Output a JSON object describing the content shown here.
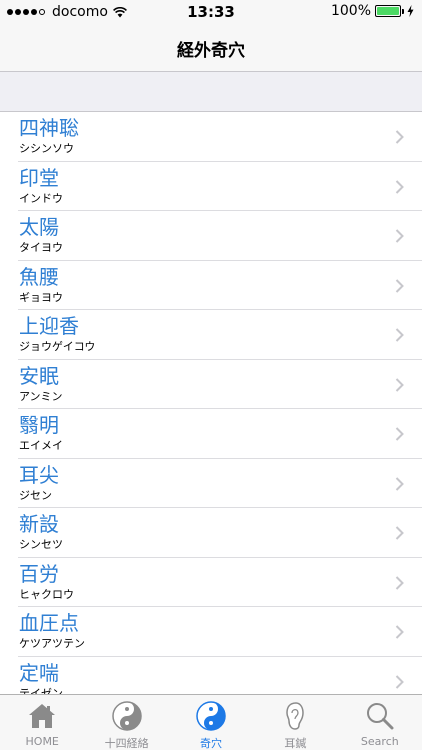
{
  "status_bar": {
    "carrier": "docomo",
    "time": "13:33",
    "battery_percent": "100%",
    "battery_level": 1.0
  },
  "nav": {
    "title": "経外奇穴"
  },
  "list": {
    "items": [
      {
        "name": "四神聡",
        "reading": "シシンソウ"
      },
      {
        "name": "印堂",
        "reading": "インドウ"
      },
      {
        "name": "太陽",
        "reading": "タイヨウ"
      },
      {
        "name": "魚腰",
        "reading": "ギョヨウ"
      },
      {
        "name": "上迎香",
        "reading": "ジョウゲイコウ"
      },
      {
        "name": "安眠",
        "reading": "アンミン"
      },
      {
        "name": "翳明",
        "reading": "エイメイ"
      },
      {
        "name": "耳尖",
        "reading": "ジセン"
      },
      {
        "name": "新設",
        "reading": "シンセツ"
      },
      {
        "name": "百労",
        "reading": "ヒャクロウ"
      },
      {
        "name": "血圧点",
        "reading": "ケツアツテン"
      },
      {
        "name": "定喘",
        "reading": "テイゼン"
      }
    ]
  },
  "tab_bar": {
    "tabs": [
      {
        "label": "HOME",
        "icon": "house-icon",
        "active": false
      },
      {
        "label": "十四経絡",
        "icon": "yin-yang-icon",
        "active": false
      },
      {
        "label": "奇穴",
        "icon": "yin-yang-icon",
        "active": true
      },
      {
        "label": "耳鍼",
        "icon": "ear-icon",
        "active": false
      },
      {
        "label": "Search",
        "icon": "search-icon",
        "active": false
      }
    ]
  },
  "colors": {
    "accent": "#1d79e6",
    "link_text": "#2f7fd3",
    "inactive": "#8e8e93",
    "battery": "#4cd964"
  }
}
